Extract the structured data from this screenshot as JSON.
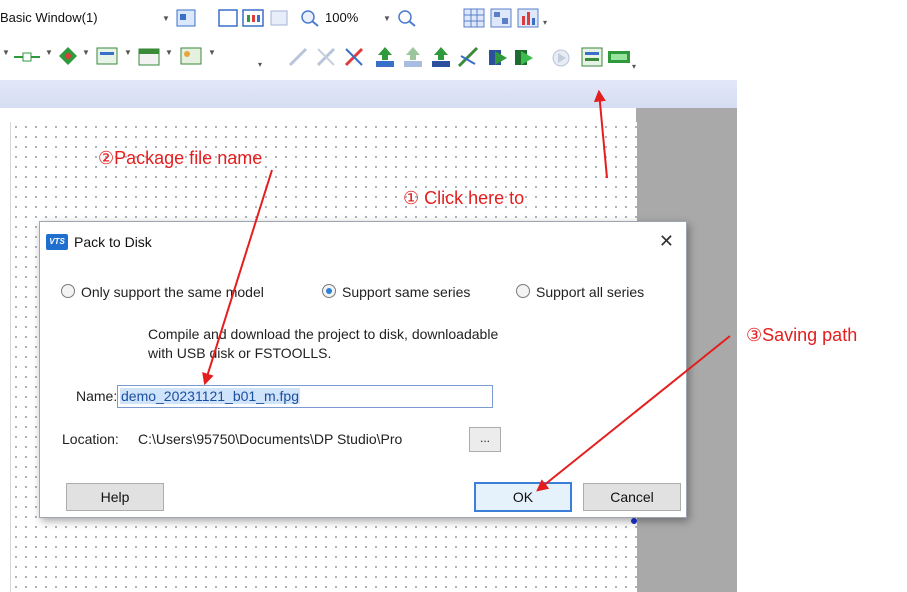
{
  "toolbar": {
    "window_select": "Basic Window(1)",
    "zoom": "100%"
  },
  "dialog": {
    "title": "Pack to Disk",
    "close": "✕",
    "app_icon_text": "VTS",
    "options": [
      {
        "label": "Only support the same model",
        "selected": false
      },
      {
        "label": "Support same series",
        "selected": true
      },
      {
        "label": "Support all series",
        "selected": false
      }
    ],
    "description_line1": "Compile and download the project to disk, downloadable",
    "description_line2": "with USB disk or FSTOOLLS.",
    "name_label": "Name:",
    "name_value": "demo_20231121_b01_m.fpg",
    "location_label": "Location:",
    "location_value": "C:\\Users\\95750\\Documents\\DP Studio\\Pro",
    "browse": "...",
    "help": "Help",
    "ok": "OK",
    "cancel": "Cancel"
  },
  "annotations": {
    "step1": "① Click  here  to",
    "step2": "②Package file name",
    "step3": "③Saving path",
    "color": "#e41e1e"
  }
}
